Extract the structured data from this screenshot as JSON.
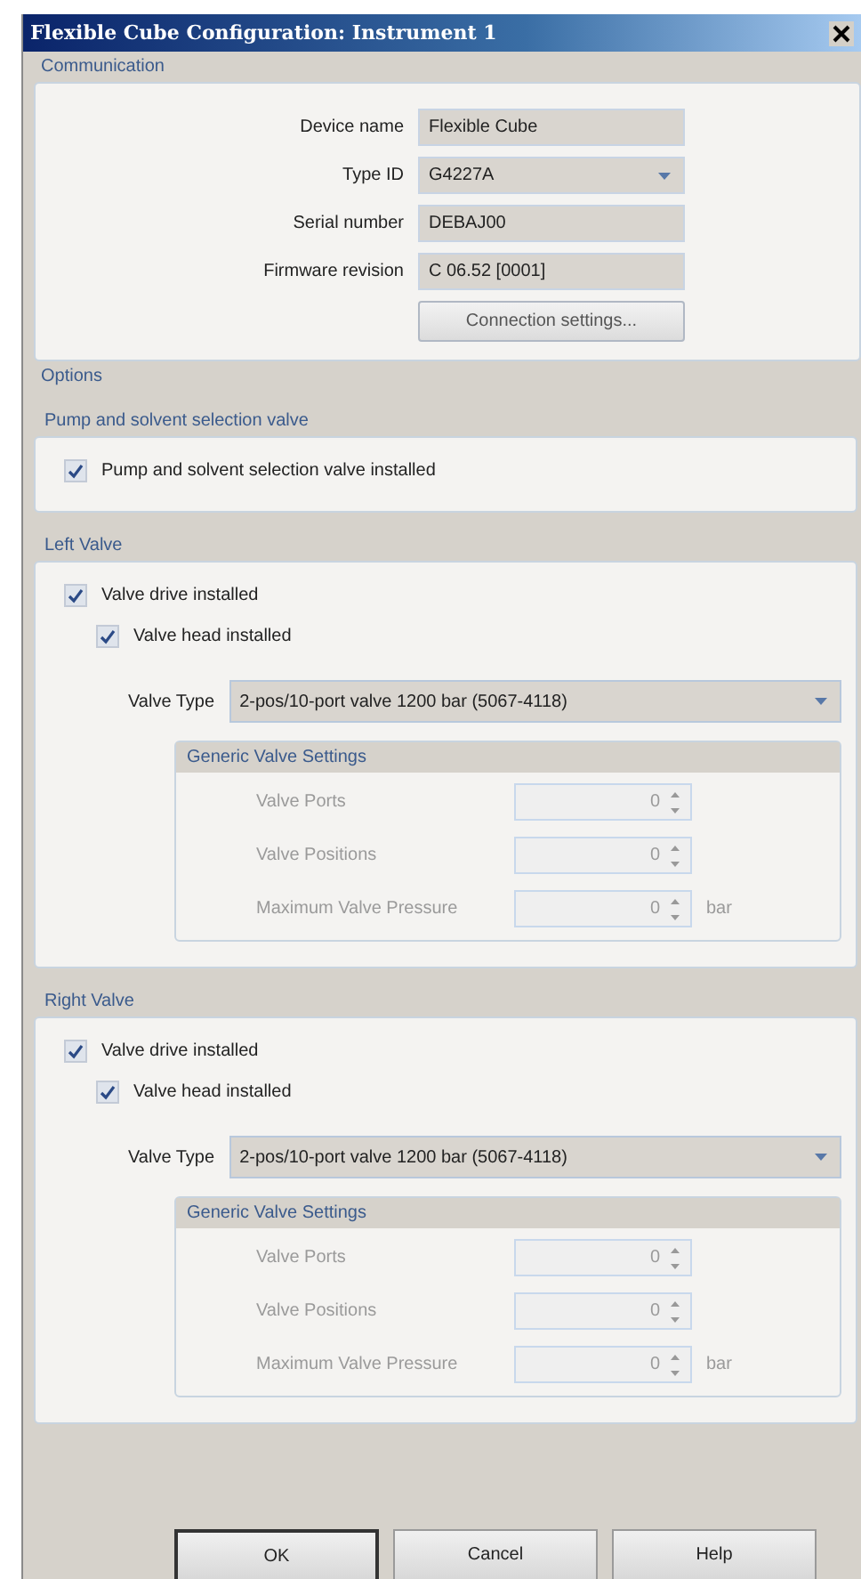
{
  "window": {
    "title": "Flexible Cube Configuration: Instrument 1"
  },
  "communication": {
    "title": "Communication",
    "fields": [
      {
        "label": "Device name",
        "value": "Flexible Cube",
        "kind": "text"
      },
      {
        "label": "Type ID",
        "value": "G4227A",
        "kind": "dropdown"
      },
      {
        "label": "Serial number",
        "value": "DEBAJ00",
        "kind": "text"
      },
      {
        "label": "Firmware revision",
        "value": "C 06.52 [0001]",
        "kind": "text"
      }
    ],
    "button": "Connection settings..."
  },
  "options": {
    "title": "Options",
    "pump": {
      "title": "Pump and solvent selection valve",
      "checkbox": {
        "label": "Pump and solvent selection valve installed",
        "checked": true
      }
    },
    "valves": [
      {
        "title": "Left Valve",
        "drive": {
          "label": "Valve drive installed",
          "checked": true
        },
        "head": {
          "label": "Valve head installed",
          "checked": true
        },
        "valve_type": {
          "label": "Valve Type",
          "value": "2-pos/10-port valve 1200 bar (5067-4118)"
        },
        "generic": {
          "title": "Generic Valve Settings",
          "settings": [
            {
              "label": "Valve Ports",
              "value": "0",
              "disabled": true
            },
            {
              "label": "Valve Positions",
              "value": "0",
              "disabled": true
            },
            {
              "label": "Maximum Valve Pressure",
              "value": "0",
              "unit": "bar",
              "disabled": true
            }
          ]
        }
      },
      {
        "title": "Right Valve",
        "drive": {
          "label": "Valve drive installed",
          "checked": true
        },
        "head": {
          "label": "Valve head installed",
          "checked": true
        },
        "valve_type": {
          "label": "Valve Type",
          "value": "2-pos/10-port valve 1200 bar (5067-4118)"
        },
        "generic": {
          "title": "Generic Valve Settings",
          "settings": [
            {
              "label": "Valve Ports",
              "value": "0",
              "disabled": true
            },
            {
              "label": "Valve Positions",
              "value": "0",
              "disabled": true
            },
            {
              "label": "Maximum Valve Pressure",
              "value": "0",
              "unit": "bar",
              "disabled": true
            }
          ]
        }
      }
    ]
  },
  "buttons": [
    {
      "label": "OK",
      "default": true
    },
    {
      "label": "Cancel",
      "default": false
    },
    {
      "label": "Help",
      "default": false
    }
  ]
}
